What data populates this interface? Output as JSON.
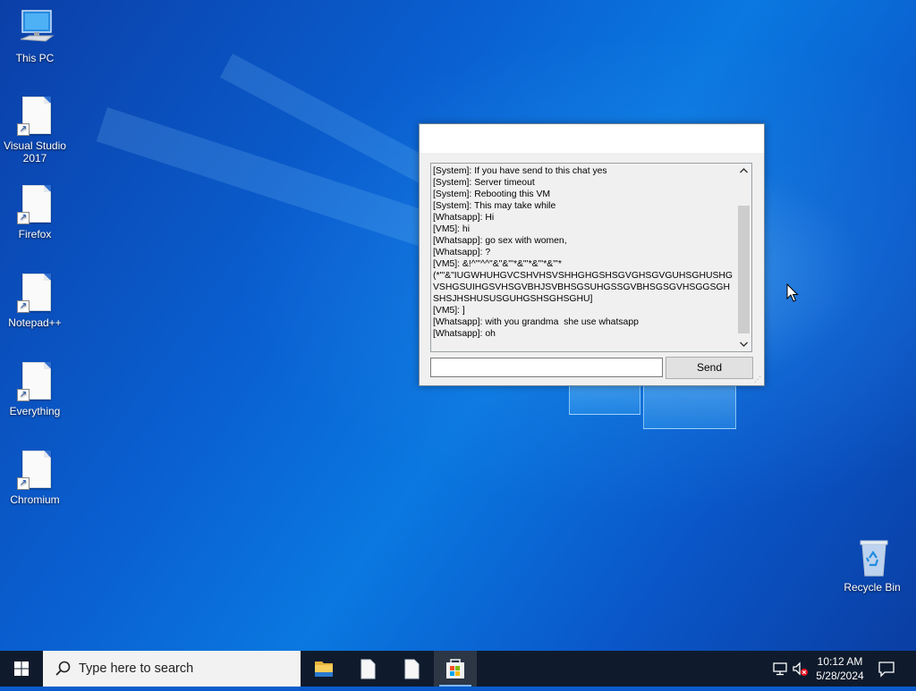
{
  "desktop": {
    "icons": [
      {
        "label": "This PC",
        "icon": "computer-icon"
      },
      {
        "label": "Visual Studio 2017",
        "icon": "file-shortcut-icon"
      },
      {
        "label": "Firefox",
        "icon": "file-shortcut-icon"
      },
      {
        "label": "Notepad++",
        "icon": "file-shortcut-icon"
      },
      {
        "label": "Everything",
        "icon": "file-shortcut-icon"
      },
      {
        "label": "Chromium",
        "icon": "file-shortcut-icon"
      },
      {
        "label": "Recycle Bin",
        "icon": "recycle-bin-icon"
      }
    ]
  },
  "chat_window": {
    "title": "",
    "lines": [
      "[System]: If you have send to this chat yes",
      "[System]: Server timeout",
      "[System]: Rebooting this VM",
      "[System]: This may take while",
      "[Whatsapp]: Hi",
      "[VM5]: hi",
      "[Whatsapp]: go sex with women,",
      "[Whatsapp]: ?",
      "[VM5]: &!^\"'^^\"&\"&\"'*&\"'*&\"'*&\"'*",
      "(*\"'&\"IUGWHUHGVCSHVHSVSHHGHGSHSGVGHSGVGUHSGHUSHGVSHGSUIHGSVHSGVBHJSVBHSGSUHGSSGVBHSGSGVHSGGSGHSHSJHSHUSUSGUHGSHSGHSGHU]",
      "[VM5]: ]",
      "[Whatsapp]: with you grandma  she use whatsapp",
      "[Whatsapp]: oh"
    ],
    "input_value": "",
    "send_label": "Send"
  },
  "taskbar": {
    "search_placeholder": "Type here to search",
    "apps": [
      "file-explorer-icon",
      "file-icon",
      "file-icon",
      "store-icon"
    ],
    "tray": [
      "network-icon",
      "volume-muted-icon"
    ],
    "time": "10:12 AM",
    "date": "5/28/2024"
  },
  "colors": {
    "accent": "#0a78e0",
    "taskbar": "#0f1b2c"
  }
}
